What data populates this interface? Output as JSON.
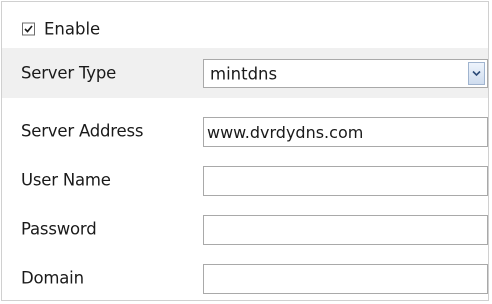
{
  "enable": {
    "label": "Enable",
    "checked": true
  },
  "fields": {
    "server_type": {
      "label": "Server Type",
      "value": "mintdns"
    },
    "server_address": {
      "label": "Server Address",
      "value": "www.dvrdydns.com"
    },
    "user_name": {
      "label": "User Name",
      "value": ""
    },
    "password": {
      "label": "Password",
      "value": ""
    },
    "domain": {
      "label": "Domain",
      "value": ""
    }
  },
  "icons": {
    "checkbox": "checkmark-icon",
    "dropdown": "chevron-down-icon"
  },
  "colors": {
    "alt_row": "#f0f0f0",
    "border": "#a9a9a9",
    "dropdown_button": "#cfdcee"
  }
}
